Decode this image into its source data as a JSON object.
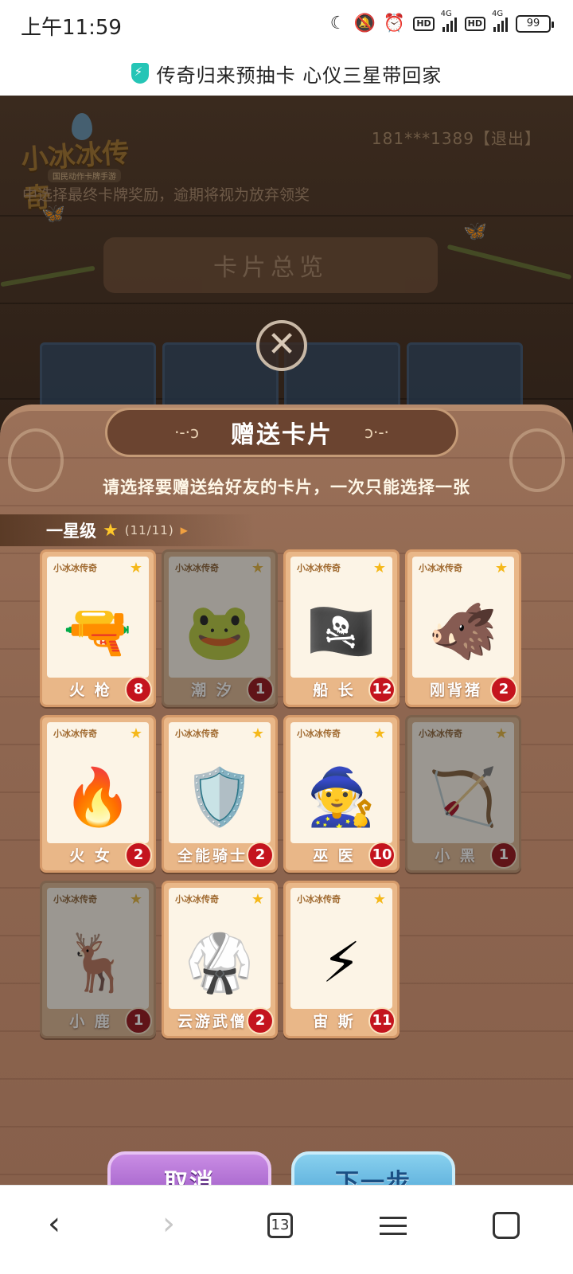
{
  "status_bar": {
    "time": "上午11:59",
    "net1": "4G",
    "net2": "4G",
    "hd1": "HD",
    "hd2": "HD",
    "battery": "99"
  },
  "browser": {
    "page_title": "传奇归来预抽卡 心仪三星带回家",
    "tab_count": "13"
  },
  "game": {
    "logo_text": "小冰冰传奇",
    "logo_sub": "国民动作卡牌手游",
    "account": "181***1389【退出】",
    "notice": "中选择最终卡牌奖励，逾期将视为放弃领奖",
    "overview_title": "卡片总览"
  },
  "dialog": {
    "title": "赠送卡片",
    "instruction": "请选择要赠送给好友的卡片，一次只能选择一张",
    "tier_label": "一星级",
    "tier_count": "(11/11)",
    "cancel_label": "取消",
    "next_label": "下一步"
  },
  "cards": [
    {
      "name": "火 枪",
      "count": "8",
      "dim": false,
      "art": "🔫"
    },
    {
      "name": "潮 汐",
      "count": "1",
      "dim": true,
      "art": "🐸"
    },
    {
      "name": "船 长",
      "count": "12",
      "dim": false,
      "art": "🏴‍☠️"
    },
    {
      "name": "刚背猪",
      "count": "2",
      "dim": false,
      "art": "🐗"
    },
    {
      "name": "火 女",
      "count": "2",
      "dim": false,
      "art": "🔥"
    },
    {
      "name": "全能骑士",
      "count": "2",
      "dim": false,
      "art": "🛡️"
    },
    {
      "name": "巫 医",
      "count": "10",
      "dim": false,
      "art": "🧙"
    },
    {
      "name": "小 黑",
      "count": "1",
      "dim": true,
      "art": "🏹"
    },
    {
      "name": "小 鹿",
      "count": "1",
      "dim": true,
      "art": "🦌"
    },
    {
      "name": "云游武僧",
      "count": "2",
      "dim": false,
      "art": "🥋"
    },
    {
      "name": "宙 斯",
      "count": "11",
      "dim": false,
      "art": "⚡"
    }
  ],
  "colors": {
    "badge": "#c4141e",
    "star": "#f5b81a",
    "cancel": "#9b58c4",
    "next": "#4da4d6"
  }
}
